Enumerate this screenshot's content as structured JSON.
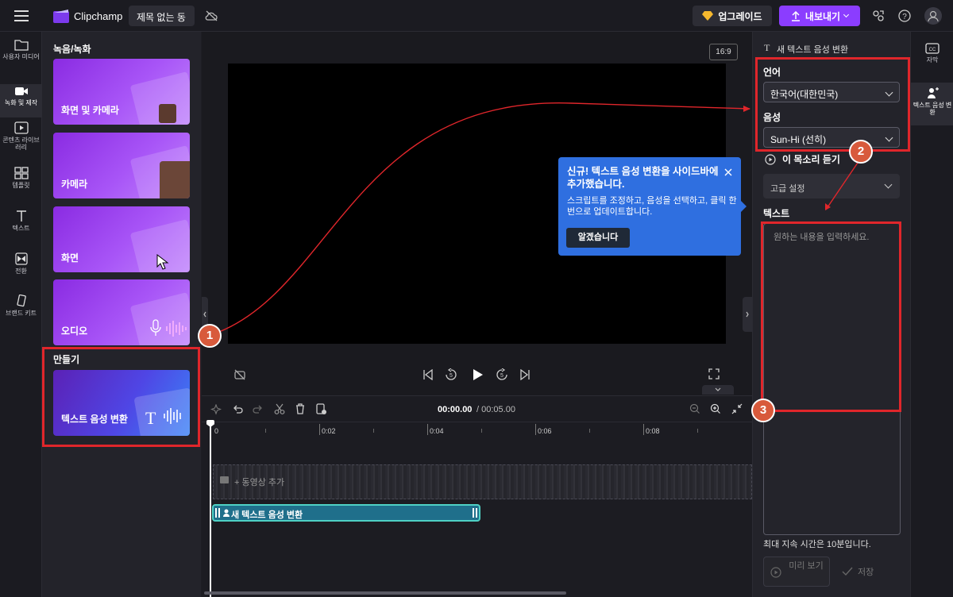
{
  "topbar": {
    "app_name": "Clipchamp",
    "project_title": "제목 없는 동",
    "upgrade_label": "업그레이드",
    "export_label": "내보내기"
  },
  "leftnav": {
    "items": [
      {
        "label": "사용자 미디어",
        "icon": "folder-icon"
      },
      {
        "label": "녹화 및 제작",
        "icon": "video-camera-icon"
      },
      {
        "label": "콘텐츠 라이브러리",
        "icon": "library-icon"
      },
      {
        "label": "템플릿",
        "icon": "template-icon"
      },
      {
        "label": "텍스트",
        "icon": "text-icon"
      },
      {
        "label": "전환",
        "icon": "transition-icon"
      },
      {
        "label": "브랜드 키트",
        "icon": "brand-kit-icon"
      }
    ]
  },
  "panel": {
    "record_heading": "녹음/녹화",
    "cards": [
      {
        "label": "화면 및 카메라"
      },
      {
        "label": "카메라"
      },
      {
        "label": "화면"
      },
      {
        "label": "오디오"
      }
    ],
    "create_heading": "만들기",
    "tts_card_label": "텍스트 음성 변환"
  },
  "stage": {
    "aspect_ratio": "16:9"
  },
  "tooltip": {
    "title": "신규! 텍스트 음성 변환을 사이드바에 추가했습니다.",
    "body": "스크립트를 조정하고, 음성을 선택하고, 클릭 한 번으로 업데이트합니다.",
    "button": "알겠습니다"
  },
  "timeline": {
    "time_current": "00:00.00",
    "time_total": "/ 00:05.00",
    "ticks": [
      "0",
      "0:02",
      "0:04",
      "0:06",
      "0:08"
    ],
    "add_video_label": "+ 동영상 추가",
    "tts_clip_label": "새 텍스트 음성 변환"
  },
  "right_panel": {
    "header": "새 텍스트 음성 변환",
    "language_label": "언어",
    "language_value": "한국어(대한민국)",
    "voice_label": "음성",
    "voice_value": "Sun-Hi (선히)",
    "listen_label": "이 목소리 듣기",
    "advanced_label": "고급 설정",
    "text_label": "텍스트",
    "text_placeholder": "원하는 내용을 입력하세요.",
    "duration_note": "최대 지속 시간은 10분입니다.",
    "preview_label": "미리 보기",
    "save_label": "저장"
  },
  "right_tabs": [
    {
      "label": "자막",
      "icon": "captions-icon"
    },
    {
      "label": "텍스트 음성 변환",
      "icon": "tts-icon"
    }
  ],
  "annotations": [
    "1",
    "2",
    "3"
  ],
  "colors": {
    "accent": "#8b3dff",
    "card": "#a855f7",
    "highlight": "#e0262b",
    "tooltip": "#2f6fe0",
    "badge": "#d85a3c",
    "clip": "#1f6f8b"
  }
}
